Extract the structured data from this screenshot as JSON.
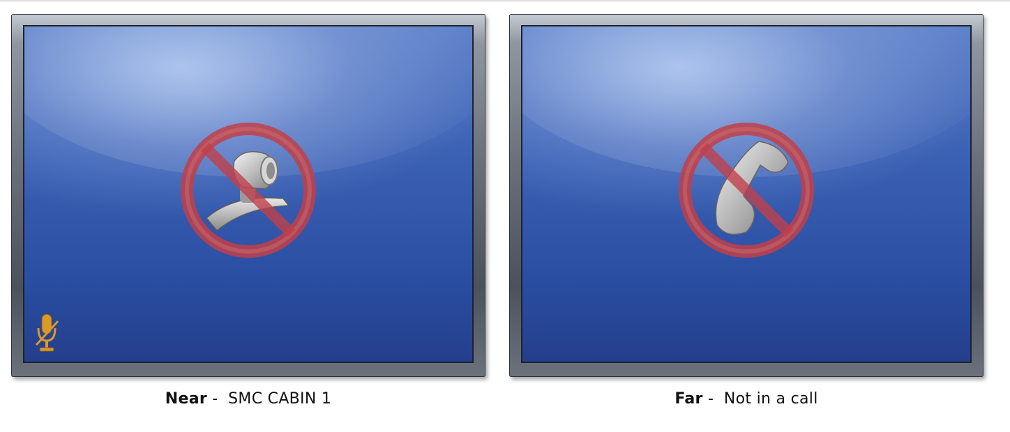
{
  "near": {
    "role_label": "Near",
    "separator": " -  ",
    "site_name": "SMC CABIN 1",
    "status_icon": "no-camera-icon",
    "mute_icon": "microphone-muted-icon"
  },
  "far": {
    "role_label": "Far",
    "separator": " -  ",
    "site_name": "Not in a call",
    "status_icon": "no-call-icon"
  },
  "colors": {
    "screen_blue": "#2f56a8",
    "prohibit_red": "#c0404a",
    "mute_orange": "#d99a2b"
  }
}
